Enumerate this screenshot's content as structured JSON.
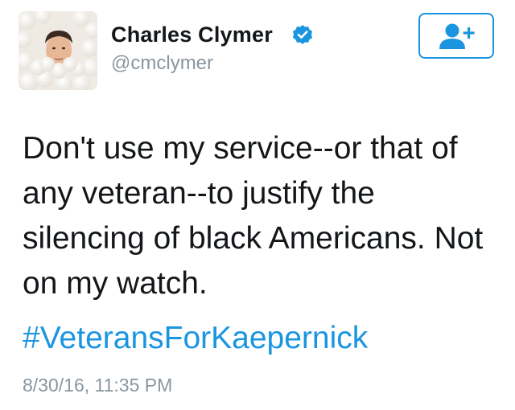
{
  "author": {
    "display_name": "Charles Clymer",
    "handle": "@cmclymer",
    "verified": true,
    "avatar_icon": "avatar-photo-icon"
  },
  "follow_button": {
    "icon": "add-user-icon"
  },
  "tweet": {
    "lines": [
      "Don't use my service--or that of",
      "any veteran--to justify the",
      "silencing of black Americans. Not",
      "on my watch."
    ],
    "hashtag": "#VeteransForKaepernick",
    "timestamp": "8/30/16, 11:35 PM"
  },
  "colors": {
    "accent": "#1b95e0",
    "text": "#14171a",
    "muted": "#8a959e"
  }
}
